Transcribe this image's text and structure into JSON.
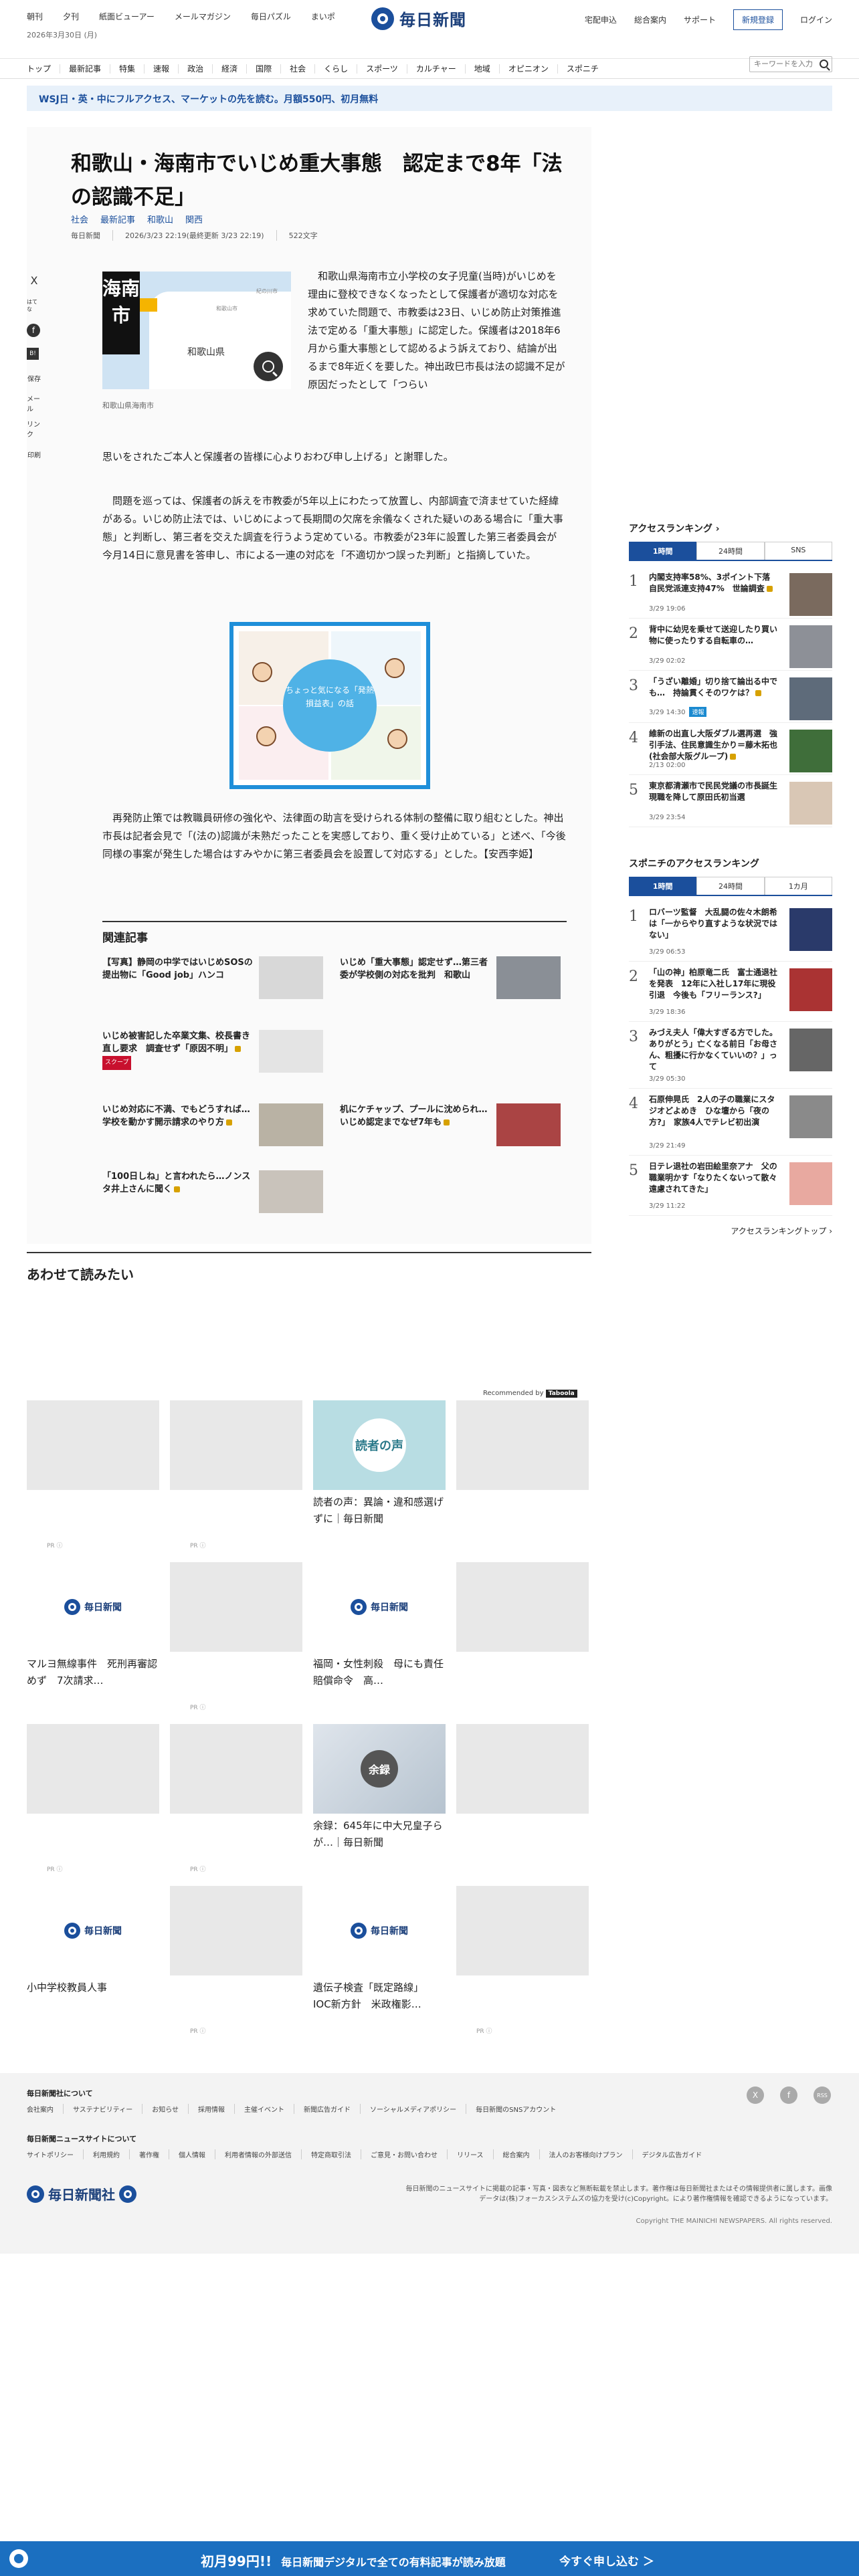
{
  "header": {
    "top_links": [
      "朝刊",
      "夕刊",
      "紙面ビューアー",
      "メールマガジン",
      "毎日パズル",
      "まいポ"
    ],
    "date": "2026年3月30日 (月)",
    "logo_text": "毎日新聞",
    "right_links": [
      "宅配申込",
      "総合案内",
      "サポート"
    ],
    "register_label": "新規登録",
    "login_label": "ログイン"
  },
  "nav": {
    "items": [
      "トップ",
      "最新記事",
      "特集",
      "速報",
      "政治",
      "経済",
      "国際",
      "社会",
      "くらし",
      "スポーツ",
      "カルチャー",
      "地域",
      "オピニオン",
      "スポニチ"
    ],
    "search_placeholder": "キーワードを入力"
  },
  "promo": {
    "text": "WSJ日・英・中にフルアクセス、マーケットの先を読む。月額550円、初月無料"
  },
  "article": {
    "headline": "和歌山・海南市でいじめ重大事態　認定まで8年「法の認識不足」",
    "tags": [
      "社会",
      "最新記事",
      "和歌山",
      "関西"
    ],
    "meta": [
      "毎日新聞",
      "2026/3/23 22:19(最終更新 3/23 22:19)",
      "522文字"
    ],
    "map": {
      "label": "海南市",
      "pref": "和歌山県",
      "small1": "和歌山市",
      "small2": "紀の川市",
      "caption": "和歌山県海南市"
    },
    "para1": "　和歌山県海南市立小学校の女子児童(当時)がいじめを理由に登校できなくなったとして保護者が適切な対応を求めていた問題で、市教委は23日、いじめ防止対策推進法で定める「重大事態」に認定した。保護者は2018年6月から重大事態として認めるよう訴えており、結論が出るまで8年近くを要した。神出政巳市長は法の認識不足が原因だったとして「つらい",
    "para1b": "思いをされたご本人と保護者の皆様に心よりおわび申し上げる」と謝罪した。",
    "para2": "　問題を巡っては、保護者の訴えを市教委が5年以上にわたって放置し、内部調査で済ませていた経緯がある。いじめ防止法では、いじめによって長期間の欠席を余儀なくされた疑いのある場合に「重大事態」と判断し、第三者を交えた調査を行うよう定めている。市教委が23年に設置した第三者委員会が今月14日に意見書を答申し、市による一連の対応を「不適切かつ誤った判断」と指摘していた。",
    "illust_text": "ちょっと気になる「発熱損益表」の話",
    "para3": "　再発防止策では教職員研修の強化や、法律面の助言を受けられる体制の整備に取り組むとした。神出市長は記者会見で「(法の)認識が未熟だったことを実感しており、重く受け止めている」と述べ、「今後同様の事案が発生した場合はすみやかに第三者委員会を設置して対応する」とした。【安西李姫】"
  },
  "share_icons": [
    "X",
    "はてな",
    "f",
    "B!",
    "保存",
    "メール",
    "リンク",
    "印刷"
  ],
  "related": {
    "title": "関連記事",
    "items": [
      {
        "text": "【写真】静岡の中学ではいじめSOSの提出物に「Good job」ハンコ",
        "badge": ""
      },
      {
        "text": "いじめ「重大事態」認定せず…第三者委が学校側の対応を批判　和歌山",
        "badge": ""
      },
      {
        "text": "いじめ被害記した卒業文集、校長書き直し要求　調査せず「原因不明」",
        "badge": "スクープ"
      },
      {
        "text": "机にケチャップ、プールに沈められ…いじめ認定までなぜ7年も",
        "badge": ""
      },
      {
        "text": "いじめ対応に不満、でもどうすれば…学校を動かす開示請求のやり方",
        "badge": ""
      },
      {
        "text": "「100日しね」と言われたら…ノンスタ井上さんに聞く",
        "badge": ""
      }
    ]
  },
  "ranking": {
    "title": "アクセスランキング",
    "tabs": [
      "1時間",
      "24時間",
      "SNS"
    ],
    "items": [
      {
        "num": "1",
        "text": "内閣支持率58%、3ポイント下落　自民党派連支持47%　世論調査",
        "date": "3/29 19:06",
        "badge": ""
      },
      {
        "num": "2",
        "text": "背中に幼児を乗せて送迎したり買い物に使ったりする自転車の…",
        "date": "3/29 02:02",
        "badge": ""
      },
      {
        "num": "3",
        "text": "「うざい離婚」切り捨て論出る中でも…　持論貫くそのワケは？",
        "date": "3/29 14:30",
        "badge": "速報"
      },
      {
        "num": "4",
        "text": "維新の出直し大阪ダブル選再選　強引手法、住民意識生かり＝藤木拓也(社会部大阪グループ)",
        "date": "2/13 02:00",
        "badge": ""
      },
      {
        "num": "5",
        "text": "東京都清瀬市で民民党議の市長誕生　現職を降して原田氏初当選",
        "date": "3/29 23:54",
        "badge": ""
      }
    ]
  },
  "sponichi": {
    "title": "スポニチのアクセスランキング",
    "tabs": [
      "1時間",
      "24時間",
      "1カ月"
    ],
    "items": [
      {
        "num": "1",
        "text": "ロバーツ監督　大乱闘の佐々木朗希は「一からやり直すような状況ではない」",
        "date": "3/29 06:53"
      },
      {
        "num": "2",
        "text": "「山の神」柏原竜二氏　富士通退社を発表　12年に入社し17年に現役引退　今後も「フリーランス?」",
        "date": "3/29 18:36"
      },
      {
        "num": "3",
        "text": "みづえ夫人「偉大すぎる方でした。ありがとう」亡くなる前日「お母さん、粗擾に行かなくていいの？」って",
        "date": "3/29 05:30"
      },
      {
        "num": "4",
        "text": "石原伸晃氏　2人の子の職業にスタジオどよめき　ひな壇から「夜の方?」　家族4人でテレビ初出演",
        "date": "3/29 21:49"
      },
      {
        "num": "5",
        "text": "日テレ退社の岩田絵里奈アナ　父の職業明かす「なりたくないって散々遠慮されてきた」",
        "date": "3/29 11:22"
      }
    ],
    "more_label": "アクセスランキングトップ"
  },
  "recommend": {
    "title": "あわせて読みたい",
    "by_label": "Recommended by",
    "by_brand": "Taboola",
    "pr": "PR ⓘ",
    "captions": {
      "voice": "読者の声：異論・違和感選げずに｜毎日新聞",
      "maru": "マルヨ無線事件　死刑再審認めず　7次請求…",
      "fukuoka": "福岡・女性刺殺　母にも責任　賠償命令　高…",
      "yoroku": "余録：645年に中大兄皇子らが…｜毎日新聞",
      "staff": "小中学校教員人事",
      "doping": "遺伝子検査「既定路線」　IOC新方針　米政権影…"
    },
    "voice_img_text": "読者の声",
    "yoroku_img_text": "余録",
    "logo_text": "毎日新聞"
  },
  "footer": {
    "h1": "毎日新聞社について",
    "links1": [
      "会社案内",
      "サステナビリティー",
      "お知らせ",
      "採用情報",
      "主催イベント",
      "新聞広告ガイド",
      "ソーシャルメディアポリシー",
      "毎日新聞のSNSアカウント"
    ],
    "h2": "毎日新聞ニュースサイトについて",
    "links2": [
      "サイトポリシー",
      "利用規約",
      "著作権",
      "個人情報",
      "利用者情報の外部送信",
      "特定商取引法",
      "ご意見・お問い合わせ",
      "リリース",
      "総合案内",
      "法人のお客様向けプラン",
      "デジタル広告ガイド"
    ],
    "logo_text": "毎日新聞社",
    "note": "毎日新聞のニュースサイトに掲載の記事・写真・図表など無断転載を禁止します。著作権は毎日新聞社またはその情報提供者に属します。画像データは(株)フォーカスシステムズの協力を受け(c)Copyright。により著作権情報を確認できるようになっています。",
    "copyright": "Copyright THE MAINICHI NEWSPAPERS. All rights reserved.",
    "social": [
      "X",
      "f",
      "RSS"
    ]
  },
  "bottom_bar": {
    "text": "初月99円!!",
    "sub": "毎日新聞デジタルで全ての有料記事が読み放題",
    "cta": "今すぐ申し込む ＞"
  },
  "colors": {
    "brand": "#1b4f9c",
    "bar": "#1b6fc0",
    "badge_red": "#c8102e"
  }
}
